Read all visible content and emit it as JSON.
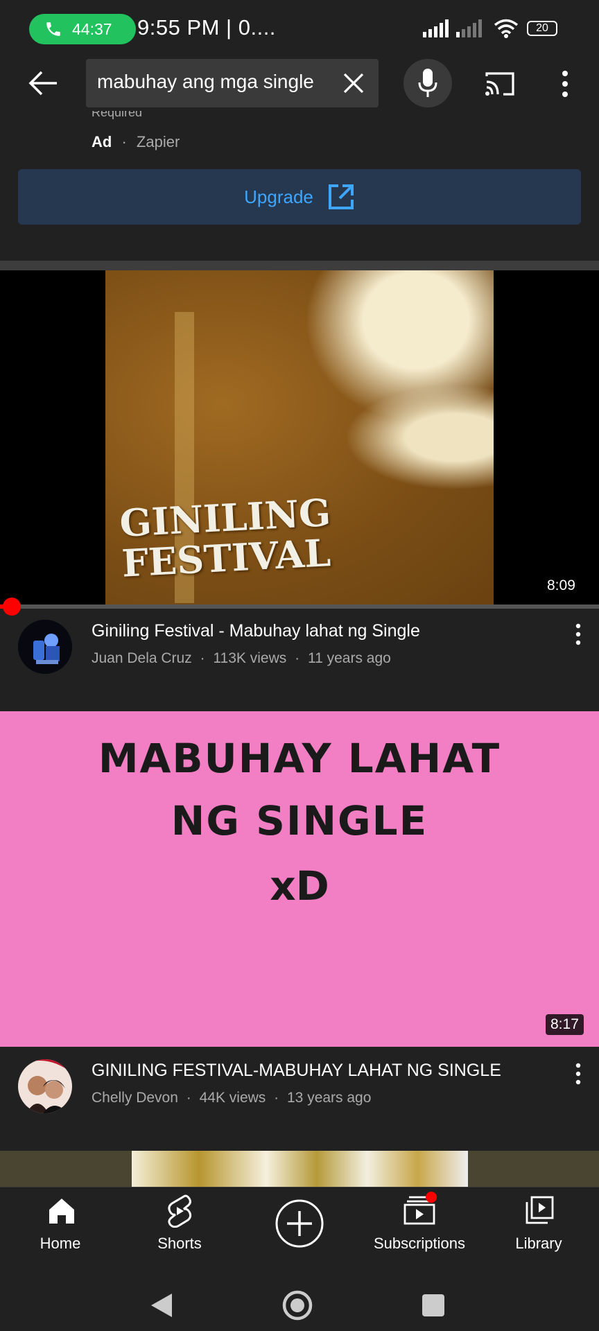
{
  "status_bar": {
    "call_timer": "44:37",
    "time_text": "9:55 PM | 0....",
    "battery": "20"
  },
  "search": {
    "query": "mabuhay ang mga single"
  },
  "ad": {
    "clipped_text": "Required",
    "label": "Ad",
    "advertiser": "Zapier",
    "button_label": "Upgrade"
  },
  "videos": [
    {
      "thumbnail_text": "GINILING FESTIVAL",
      "duration": "8:09",
      "title": "Giniling Festival - Mabuhay lahat ng Single",
      "channel": "Juan Dela Cruz",
      "views": "113K views",
      "age": "11 years ago"
    },
    {
      "thumbnail_lines": [
        "MABUHAY LAHAT",
        "NG SINGLE",
        "xD"
      ],
      "duration": "8:17",
      "title": "GINILING FESTIVAL-MABUHAY LAHAT NG SINGLE",
      "channel": "Chelly Devon",
      "views": "44K views",
      "age": "13 years ago"
    }
  ],
  "meta_separator": "·",
  "bottom_nav": {
    "home": "Home",
    "shorts": "Shorts",
    "subscriptions": "Subscriptions",
    "library": "Library"
  },
  "colors": {
    "background": "#212121",
    "accent_blue": "#3ea6ff",
    "call_green": "#22c35e",
    "progress_red": "#ff0000",
    "thumbnail_pink": "#f27fc4"
  }
}
